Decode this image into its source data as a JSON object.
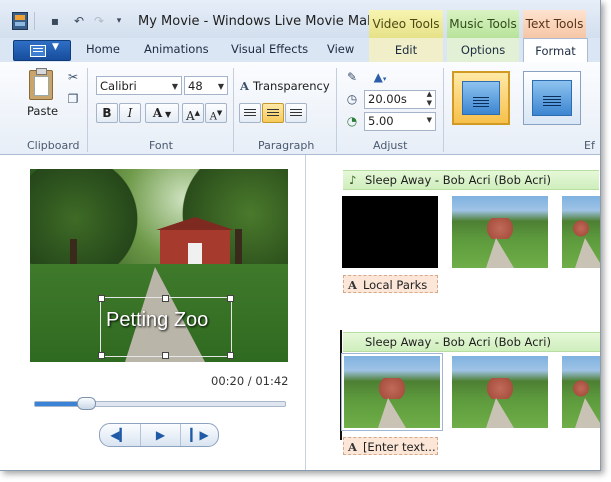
{
  "window": {
    "title": "My Movie - Windows Live Movie Maker"
  },
  "quick_access": {
    "save_icon": "save-icon",
    "undo_icon": "undo-icon",
    "redo_icon": "redo-icon",
    "customize_icon": "customize-qat-icon"
  },
  "contextual_tabs": {
    "video_tools": "Video Tools",
    "music_tools": "Music Tools",
    "text_tools": "Text Tools"
  },
  "tabs": {
    "home": "Home",
    "animations": "Animations",
    "visual_effects": "Visual Effects",
    "view": "View",
    "edit": "Edit",
    "options": "Options",
    "format": "Format"
  },
  "ribbon": {
    "clipboard": {
      "paste": "Paste",
      "group_label": "Clipboard"
    },
    "font": {
      "family": "Calibri",
      "size": "48",
      "bold": "B",
      "italic": "I",
      "color": "A",
      "grow": "A",
      "shrink": "A",
      "group_label": "Font"
    },
    "paragraph": {
      "transparency_glyph": "A",
      "transparency": "Transparency",
      "group_label": "Paragraph"
    },
    "adjust": {
      "start_time": "20.00s",
      "duration": "5.00",
      "group_label": "Adjust"
    },
    "effects": {
      "group_label_partial": "Ef"
    }
  },
  "preview": {
    "caption": "Petting Zoo",
    "timecode": "00:20 / 01:42",
    "progress_fraction": 0.196
  },
  "storyboard": {
    "music_1": "Sleep Away - Bob Acri (Bob Acri)",
    "text_tag_1": "Local Parks",
    "music_2": "Sleep Away - Bob Acri (Bob Acri)",
    "text_tag_2": "[Enter text...",
    "text_glyph": "A"
  },
  "colors": {
    "video_tools": "#e6e289",
    "music_tools": "#b8e39b",
    "text_tools": "#f6c6a6",
    "accent": "#1f5aa6"
  }
}
